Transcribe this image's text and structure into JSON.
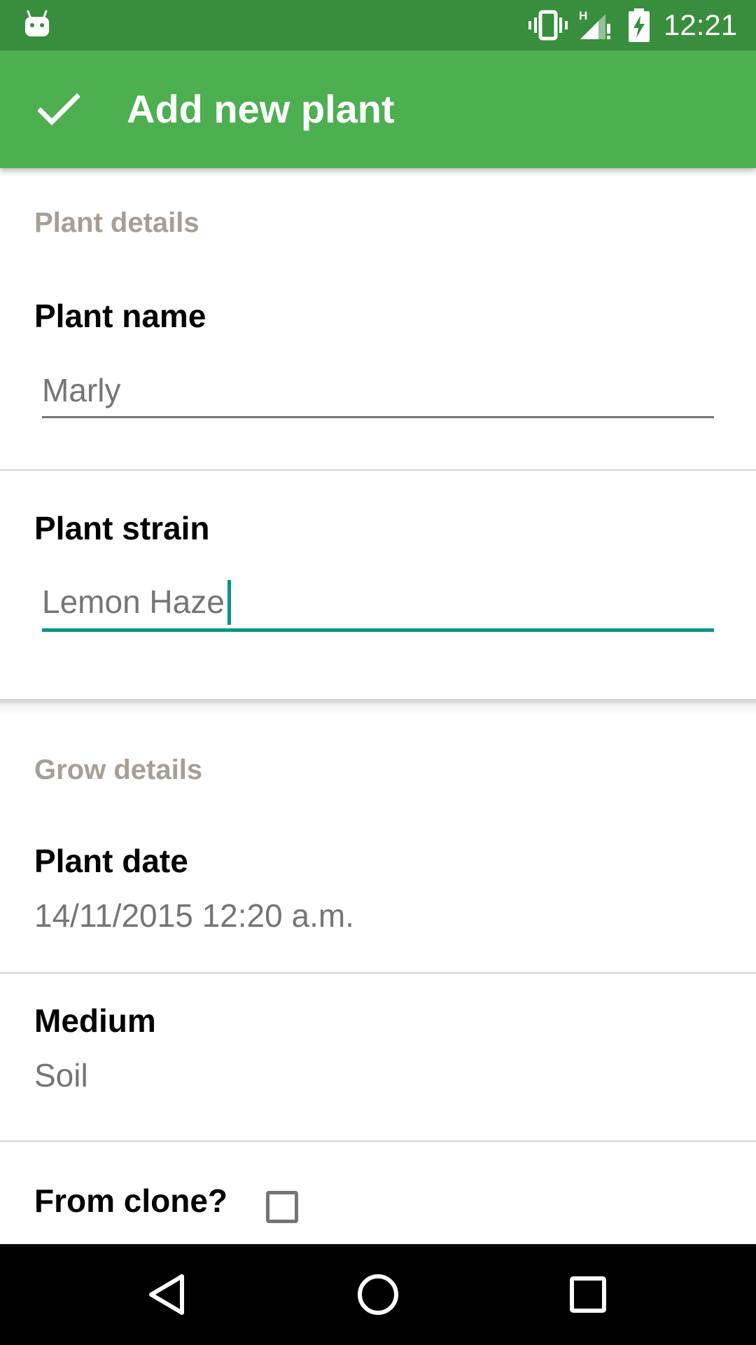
{
  "status_bar": {
    "time": "12:21",
    "network_type": "H",
    "icons": [
      "android-icon",
      "vibrate-icon",
      "signal-icon",
      "battery-charging-icon"
    ]
  },
  "app_bar": {
    "title": "Add new plant",
    "confirm_icon": "check-icon",
    "background_color": "#4caf50"
  },
  "plant_details": {
    "header": "Plant details",
    "plant_name": {
      "label": "Plant name",
      "value": "Marly"
    },
    "plant_strain": {
      "label": "Plant strain",
      "value": "Lemon Haze"
    }
  },
  "grow_details": {
    "header": "Grow details",
    "plant_date": {
      "label": "Plant date",
      "value": "14/11/2015 12:20 a.m."
    },
    "medium": {
      "label": "Medium",
      "value": "Soil"
    },
    "from_clone": {
      "label": "From clone?",
      "checked": false
    }
  },
  "nav_bar": {
    "icons": [
      "back-icon",
      "home-icon",
      "recents-icon"
    ]
  },
  "colors": {
    "status_bar": "#388e3c",
    "accent": "#009688",
    "section_header": "#a69f97"
  }
}
